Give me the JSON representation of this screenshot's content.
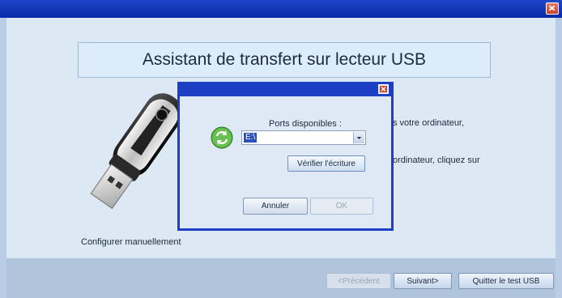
{
  "main": {
    "title": "Assistant de transfert sur lecteur USB",
    "text_line1": "s votre ordinateur,",
    "text_line2": "ordinateur, cliquez sur",
    "manual_link": "Configurer manuellement"
  },
  "buttons": {
    "previous": "<Précédent",
    "next": "Suivant>",
    "quit": "Quitter le test USB"
  },
  "dialog": {
    "ports_label": "Ports disponibles :",
    "port_value": "E:\\",
    "verify_button": "Vérifier l'écriture",
    "cancel_button": "Annuler",
    "ok_button": "OK"
  },
  "colors": {
    "titlebar": "#1e46c8",
    "dialog_frame": "#1d3fc4",
    "background": "#dce8f4"
  },
  "icons": [
    "close-icon",
    "usb-drive-icon",
    "refresh-icon",
    "chevron-down-icon"
  ]
}
